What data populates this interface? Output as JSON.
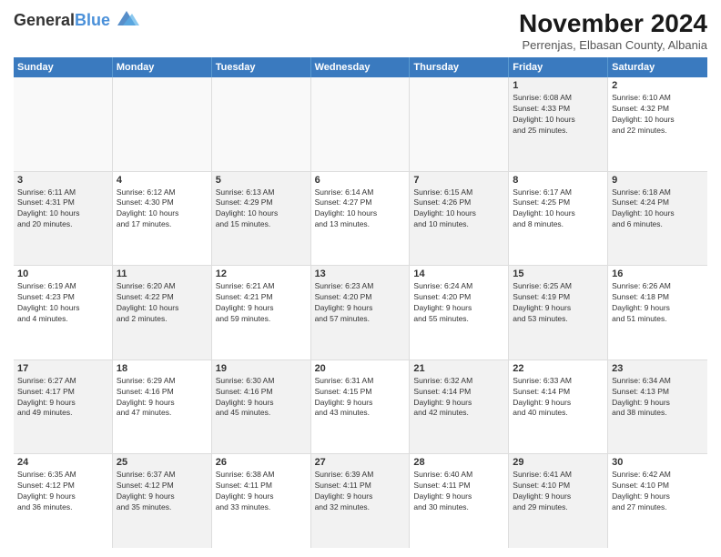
{
  "logo": {
    "line1": "General",
    "line2": "Blue"
  },
  "title": "November 2024",
  "subtitle": "Perrenjas, Elbasan County, Albania",
  "header_days": [
    "Sunday",
    "Monday",
    "Tuesday",
    "Wednesday",
    "Thursday",
    "Friday",
    "Saturday"
  ],
  "weeks": [
    [
      {
        "day": "",
        "info": "",
        "empty": true
      },
      {
        "day": "",
        "info": "",
        "empty": true
      },
      {
        "day": "",
        "info": "",
        "empty": true
      },
      {
        "day": "",
        "info": "",
        "empty": true
      },
      {
        "day": "",
        "info": "",
        "empty": true
      },
      {
        "day": "1",
        "info": "Sunrise: 6:08 AM\nSunset: 4:33 PM\nDaylight: 10 hours\nand 25 minutes.",
        "shaded": true
      },
      {
        "day": "2",
        "info": "Sunrise: 6:10 AM\nSunset: 4:32 PM\nDaylight: 10 hours\nand 22 minutes.",
        "shaded": false
      }
    ],
    [
      {
        "day": "3",
        "info": "Sunrise: 6:11 AM\nSunset: 4:31 PM\nDaylight: 10 hours\nand 20 minutes.",
        "shaded": true
      },
      {
        "day": "4",
        "info": "Sunrise: 6:12 AM\nSunset: 4:30 PM\nDaylight: 10 hours\nand 17 minutes.",
        "shaded": false
      },
      {
        "day": "5",
        "info": "Sunrise: 6:13 AM\nSunset: 4:29 PM\nDaylight: 10 hours\nand 15 minutes.",
        "shaded": true
      },
      {
        "day": "6",
        "info": "Sunrise: 6:14 AM\nSunset: 4:27 PM\nDaylight: 10 hours\nand 13 minutes.",
        "shaded": false
      },
      {
        "day": "7",
        "info": "Sunrise: 6:15 AM\nSunset: 4:26 PM\nDaylight: 10 hours\nand 10 minutes.",
        "shaded": true
      },
      {
        "day": "8",
        "info": "Sunrise: 6:17 AM\nSunset: 4:25 PM\nDaylight: 10 hours\nand 8 minutes.",
        "shaded": false
      },
      {
        "day": "9",
        "info": "Sunrise: 6:18 AM\nSunset: 4:24 PM\nDaylight: 10 hours\nand 6 minutes.",
        "shaded": true
      }
    ],
    [
      {
        "day": "10",
        "info": "Sunrise: 6:19 AM\nSunset: 4:23 PM\nDaylight: 10 hours\nand 4 minutes.",
        "shaded": false
      },
      {
        "day": "11",
        "info": "Sunrise: 6:20 AM\nSunset: 4:22 PM\nDaylight: 10 hours\nand 2 minutes.",
        "shaded": true
      },
      {
        "day": "12",
        "info": "Sunrise: 6:21 AM\nSunset: 4:21 PM\nDaylight: 9 hours\nand 59 minutes.",
        "shaded": false
      },
      {
        "day": "13",
        "info": "Sunrise: 6:23 AM\nSunset: 4:20 PM\nDaylight: 9 hours\nand 57 minutes.",
        "shaded": true
      },
      {
        "day": "14",
        "info": "Sunrise: 6:24 AM\nSunset: 4:20 PM\nDaylight: 9 hours\nand 55 minutes.",
        "shaded": false
      },
      {
        "day": "15",
        "info": "Sunrise: 6:25 AM\nSunset: 4:19 PM\nDaylight: 9 hours\nand 53 minutes.",
        "shaded": true
      },
      {
        "day": "16",
        "info": "Sunrise: 6:26 AM\nSunset: 4:18 PM\nDaylight: 9 hours\nand 51 minutes.",
        "shaded": false
      }
    ],
    [
      {
        "day": "17",
        "info": "Sunrise: 6:27 AM\nSunset: 4:17 PM\nDaylight: 9 hours\nand 49 minutes.",
        "shaded": true
      },
      {
        "day": "18",
        "info": "Sunrise: 6:29 AM\nSunset: 4:16 PM\nDaylight: 9 hours\nand 47 minutes.",
        "shaded": false
      },
      {
        "day": "19",
        "info": "Sunrise: 6:30 AM\nSunset: 4:16 PM\nDaylight: 9 hours\nand 45 minutes.",
        "shaded": true
      },
      {
        "day": "20",
        "info": "Sunrise: 6:31 AM\nSunset: 4:15 PM\nDaylight: 9 hours\nand 43 minutes.",
        "shaded": false
      },
      {
        "day": "21",
        "info": "Sunrise: 6:32 AM\nSunset: 4:14 PM\nDaylight: 9 hours\nand 42 minutes.",
        "shaded": true
      },
      {
        "day": "22",
        "info": "Sunrise: 6:33 AM\nSunset: 4:14 PM\nDaylight: 9 hours\nand 40 minutes.",
        "shaded": false
      },
      {
        "day": "23",
        "info": "Sunrise: 6:34 AM\nSunset: 4:13 PM\nDaylight: 9 hours\nand 38 minutes.",
        "shaded": true
      }
    ],
    [
      {
        "day": "24",
        "info": "Sunrise: 6:35 AM\nSunset: 4:12 PM\nDaylight: 9 hours\nand 36 minutes.",
        "shaded": false
      },
      {
        "day": "25",
        "info": "Sunrise: 6:37 AM\nSunset: 4:12 PM\nDaylight: 9 hours\nand 35 minutes.",
        "shaded": true
      },
      {
        "day": "26",
        "info": "Sunrise: 6:38 AM\nSunset: 4:11 PM\nDaylight: 9 hours\nand 33 minutes.",
        "shaded": false
      },
      {
        "day": "27",
        "info": "Sunrise: 6:39 AM\nSunset: 4:11 PM\nDaylight: 9 hours\nand 32 minutes.",
        "shaded": true
      },
      {
        "day": "28",
        "info": "Sunrise: 6:40 AM\nSunset: 4:11 PM\nDaylight: 9 hours\nand 30 minutes.",
        "shaded": false
      },
      {
        "day": "29",
        "info": "Sunrise: 6:41 AM\nSunset: 4:10 PM\nDaylight: 9 hours\nand 29 minutes.",
        "shaded": true
      },
      {
        "day": "30",
        "info": "Sunrise: 6:42 AM\nSunset: 4:10 PM\nDaylight: 9 hours\nand 27 minutes.",
        "shaded": false
      }
    ]
  ]
}
